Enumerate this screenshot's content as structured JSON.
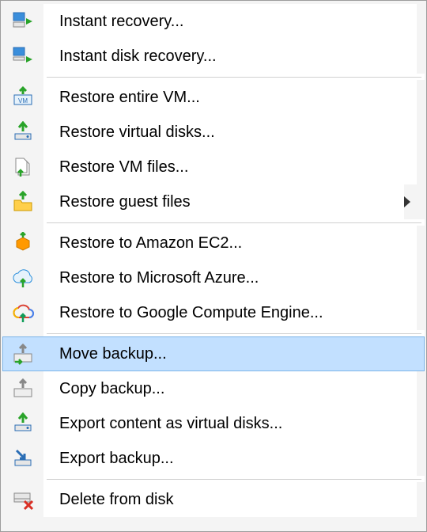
{
  "menu": {
    "items": [
      {
        "label": "Instant recovery...",
        "icon": "instant-recovery-icon",
        "submenu": false,
        "selected": false
      },
      {
        "label": "Instant disk recovery...",
        "icon": "instant-disk-recovery-icon",
        "submenu": false,
        "selected": false
      },
      {
        "separator": true
      },
      {
        "label": "Restore entire VM...",
        "icon": "restore-vm-icon",
        "submenu": false,
        "selected": false
      },
      {
        "label": "Restore virtual disks...",
        "icon": "restore-vdisks-icon",
        "submenu": false,
        "selected": false
      },
      {
        "label": "Restore VM files...",
        "icon": "restore-vmfiles-icon",
        "submenu": false,
        "selected": false
      },
      {
        "label": "Restore guest files",
        "icon": "restore-guest-files-icon",
        "submenu": true,
        "selected": false
      },
      {
        "separator": true
      },
      {
        "label": "Restore to Amazon EC2...",
        "icon": "restore-amazon-icon",
        "submenu": false,
        "selected": false
      },
      {
        "label": "Restore to Microsoft Azure...",
        "icon": "restore-azure-icon",
        "submenu": false,
        "selected": false
      },
      {
        "label": "Restore to Google Compute Engine...",
        "icon": "restore-gcp-icon",
        "submenu": false,
        "selected": false
      },
      {
        "separator": true
      },
      {
        "label": "Move backup...",
        "icon": "move-backup-icon",
        "submenu": false,
        "selected": true
      },
      {
        "label": "Copy backup...",
        "icon": "copy-backup-icon",
        "submenu": false,
        "selected": false
      },
      {
        "label": "Export content as virtual disks...",
        "icon": "export-content-icon",
        "submenu": false,
        "selected": false
      },
      {
        "label": "Export backup...",
        "icon": "export-backup-icon",
        "submenu": false,
        "selected": false
      },
      {
        "separator": true
      },
      {
        "label": "Delete from disk",
        "icon": "delete-from-disk-icon",
        "submenu": false,
        "selected": false
      }
    ]
  }
}
